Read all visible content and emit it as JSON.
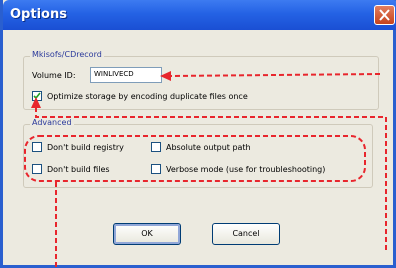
{
  "window": {
    "title": "Options"
  },
  "groups": {
    "mkisofs": {
      "legend": "Mkisofs/CDrecord",
      "volume_label": "Volume ID:",
      "volume_value": "WINLIVECD",
      "optimize_label": "Optimize storage by encoding duplicate files once",
      "optimize_checked": true
    },
    "advanced": {
      "legend": "Advanced",
      "options": [
        {
          "label": "Don't build registry",
          "checked": false
        },
        {
          "label": "Absolute output path",
          "checked": false
        },
        {
          "label": "Don't build files",
          "checked": false
        },
        {
          "label": "Verbose mode (use for troubleshooting)",
          "checked": false
        }
      ]
    }
  },
  "buttons": {
    "ok": "OK",
    "cancel": "Cancel"
  },
  "colors": {
    "annotation": "#e8262d",
    "title_bar": "#2462e4",
    "background": "#5d84c4"
  }
}
